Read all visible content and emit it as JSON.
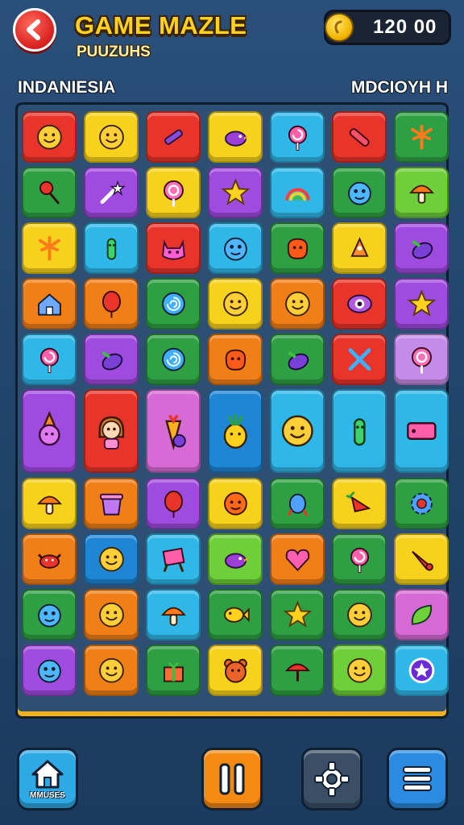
{
  "header": {
    "title": "GAME MAZLE",
    "subtitle": "PUUZUHS",
    "score": "120  00",
    "coin_icon": "coin-icon",
    "back_icon": "back-arrow-icon"
  },
  "labels": {
    "left": "INDANIESIA",
    "right": "MDCIOYH H"
  },
  "board": {
    "rows": [
      [
        {
          "color": "#e8342a",
          "icon": "smiley-face-icon"
        },
        {
          "color": "#f7d21c",
          "icon": "smiley-face-icon"
        },
        {
          "color": "#e8342a",
          "icon": "crayon-icon"
        },
        {
          "color": "#f7d21c",
          "icon": "bird-icon"
        },
        {
          "color": "#2fb7e8",
          "icon": "swirl-lollipop-icon"
        },
        {
          "color": "#e8342a",
          "icon": "candy-stick-icon"
        },
        {
          "color": "#2ea043",
          "icon": "palm-leaf-icon"
        }
      ],
      [
        {
          "color": "#2ea043",
          "icon": "pin-icon"
        },
        {
          "color": "#a04be0",
          "icon": "magic-wand-icon"
        },
        {
          "color": "#f7d21c",
          "icon": "lollipop-icon"
        },
        {
          "color": "#a04be0",
          "icon": "star-icon"
        },
        {
          "color": "#2fb7e8",
          "icon": "rainbow-icon"
        },
        {
          "color": "#2ea043",
          "icon": "monster-face-icon"
        },
        {
          "color": "#6ecf3a",
          "icon": "mushroom-icon"
        }
      ],
      [
        {
          "color": "#f7d21c",
          "icon": "palm-leaf-icon"
        },
        {
          "color": "#2fb7e8",
          "icon": "cactus-icon"
        },
        {
          "color": "#e8342a",
          "icon": "cat-face-icon"
        },
        {
          "color": "#2fb7e8",
          "icon": "monster-face-icon"
        },
        {
          "color": "#2ea043",
          "icon": "blob-icon"
        },
        {
          "color": "#f7d21c",
          "icon": "rocket-icon"
        },
        {
          "color": "#a04be0",
          "icon": "eggplant-icon"
        }
      ],
      [
        {
          "color": "#f07f18",
          "icon": "house-icon"
        },
        {
          "color": "#f07f18",
          "icon": "balloon-icon"
        },
        {
          "color": "#2ea043",
          "icon": "swirl-candy-icon"
        },
        {
          "color": "#f7d21c",
          "icon": "smiley-face-icon"
        },
        {
          "color": "#f07f18",
          "icon": "smiley-face-icon"
        },
        {
          "color": "#e8342a",
          "icon": "eye-icon"
        },
        {
          "color": "#a04be0",
          "icon": "star-icon"
        }
      ],
      [
        {
          "color": "#2fb7e8",
          "icon": "swirl-lollipop-icon"
        },
        {
          "color": "#a04be0",
          "icon": "eggplant-icon"
        },
        {
          "color": "#2ea043",
          "icon": "swirl-candy-icon"
        },
        {
          "color": "#f07f18",
          "icon": "blob-icon"
        },
        {
          "color": "#2ea043",
          "icon": "eggplant-icon"
        },
        {
          "color": "#e8342a",
          "icon": "scissors-icon"
        },
        {
          "color": "#c58be8",
          "icon": "lollipop-icon"
        }
      ],
      [
        {
          "color": "#a04be0",
          "icon": "wizard-icon"
        },
        {
          "color": "#e8342a",
          "icon": "girl-character-icon"
        },
        {
          "color": "#d66bd6",
          "icon": "carrot-character-icon"
        },
        {
          "color": "#1f86d6",
          "icon": "pineapple-character-icon"
        },
        {
          "color": "#2fb7e8",
          "icon": "smiley-face-icon"
        },
        {
          "color": "#2fb7e8",
          "icon": "cactus-icon"
        },
        {
          "color": "#2fb7e8",
          "icon": "card-icon"
        }
      ],
      [
        {
          "color": "#f7d21c",
          "icon": "mushroom-icon"
        },
        {
          "color": "#f07f18",
          "icon": "cup-icon"
        },
        {
          "color": "#a04be0",
          "icon": "balloon-icon"
        },
        {
          "color": "#f7d21c",
          "icon": "ball-icon"
        },
        {
          "color": "#2ea043",
          "icon": "candy-icon"
        },
        {
          "color": "#f7d21c",
          "icon": "carrot-icon"
        },
        {
          "color": "#2ea043",
          "icon": "gear-flower-icon"
        }
      ],
      [
        {
          "color": "#f07f18",
          "icon": "crab-icon"
        },
        {
          "color": "#1f86d6",
          "icon": "smiley-face-icon"
        },
        {
          "color": "#2fb7e8",
          "icon": "easel-icon"
        },
        {
          "color": "#6ecf3a",
          "icon": "bird-icon"
        },
        {
          "color": "#f07f18",
          "icon": "heart-icon"
        },
        {
          "color": "#2ea043",
          "icon": "swirl-lollipop-icon"
        },
        {
          "color": "#f7d21c",
          "icon": "horn-icon"
        }
      ],
      [
        {
          "color": "#2ea043",
          "icon": "monster-face-icon"
        },
        {
          "color": "#f07f18",
          "icon": "smiley-face-icon"
        },
        {
          "color": "#2fb7e8",
          "icon": "mushroom-icon"
        },
        {
          "color": "#2ea043",
          "icon": "fish-icon"
        },
        {
          "color": "#2ea043",
          "icon": "star-icon"
        },
        {
          "color": "#2ea043",
          "icon": "smiley-face-icon"
        },
        {
          "color": "#d66bd6",
          "icon": "leaf-icon"
        }
      ],
      [
        {
          "color": "#a04be0",
          "icon": "monster-face-icon"
        },
        {
          "color": "#f07f18",
          "icon": "smiley-face-icon"
        },
        {
          "color": "#2ea043",
          "icon": "gift-icon"
        },
        {
          "color": "#f7d21c",
          "icon": "bear-face-icon"
        },
        {
          "color": "#2ea043",
          "icon": "umbrella-icon"
        },
        {
          "color": "#6ecf3a",
          "icon": "smiley-face-icon"
        },
        {
          "color": "#2fb7e8",
          "icon": "star-badge-icon"
        }
      ]
    ]
  },
  "footer": {
    "home_label": "MMUSES",
    "home_icon": "home-icon",
    "pause_icon": "pause-icon",
    "settings_icon": "gear-icon",
    "menu_icon": "menu-icon"
  }
}
